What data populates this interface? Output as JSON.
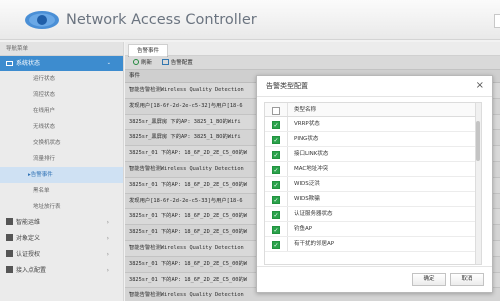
{
  "app": {
    "title": "Network Access Controller"
  },
  "sidebar": {
    "header": "导航菜单",
    "active_group": "系统状态",
    "sub_items": [
      "运行状态",
      "流控状态",
      "在线用户",
      "无线状态",
      "交换机状态",
      "流量排行",
      "▸告警事件",
      "黑名单",
      "地址放行表"
    ],
    "active_sub": 6,
    "groups": [
      {
        "label": "智能运维",
        "icon": "monitor-icon",
        "color": "#555555"
      },
      {
        "label": "对象定义",
        "icon": "object-icon",
        "color": "#555555"
      },
      {
        "label": "认证授权",
        "icon": "user-icon",
        "color": "#555555"
      },
      {
        "label": "接入点配置",
        "icon": "ap-icon",
        "color": "#555555"
      }
    ]
  },
  "main": {
    "tab": "告警事件",
    "toolbar": {
      "refresh": "刷新",
      "config": "告警配置"
    },
    "column": "事件",
    "rows": [
      "智能告警检测Wireless Quality Detection",
      "发现用户[18-6f-2d-2e-c5-32]与用户[18-6",
      "3825sr_黑屏房 下的AP: 3825_1_BO的Wifi",
      "3825sr_黑屏房 下的AP: 3825_1_BO的Wifi",
      "3825sr_01 下的AP: 18_6F_2D_2E_C5_00的W",
      "智能告警检测Wireless Quality Detection",
      "3825sr_01 下的AP: 18_6F_2D_2E_C5_00的W",
      "发现用户[18-6f-2d-2e-c5-33]与用户[18-6",
      "3825sr_01 下的AP: 18_6F_2D_2E_C5_00的W",
      "3825sr_01 下的AP: 18_6F_2D_2E_C5_00的W",
      "智能告警检测Wireless Quality Detection",
      "3825sr_01 下的AP: 18_6F_2D_2E_C5_00的W",
      "3825sr_01 下的AP: 18_6F_2D_2E_C5_00的W",
      "智能告警检测Wireless Quality Detection"
    ]
  },
  "dialog": {
    "title": "告警类型配置",
    "close": "×",
    "column_name": "类型名称",
    "items": [
      {
        "label": "VRRP状态",
        "checked": true
      },
      {
        "label": "PING状态",
        "checked": true
      },
      {
        "label": "接口LINK状态",
        "checked": true
      },
      {
        "label": "MAC地址冲突",
        "checked": true
      },
      {
        "label": "WIDS泛洪",
        "checked": true
      },
      {
        "label": "WIDS欺骗",
        "checked": true
      },
      {
        "label": "认证服务器状态",
        "checked": true
      },
      {
        "label": "钓鱼AP",
        "checked": true
      },
      {
        "label": "有干扰的邻居AP",
        "checked": true
      }
    ],
    "ok": "确定",
    "cancel": "取消"
  },
  "colors": {
    "accent": "#3d8ccf",
    "check": "#2aa24b",
    "active_sub_bg": "#cfe1f3"
  }
}
